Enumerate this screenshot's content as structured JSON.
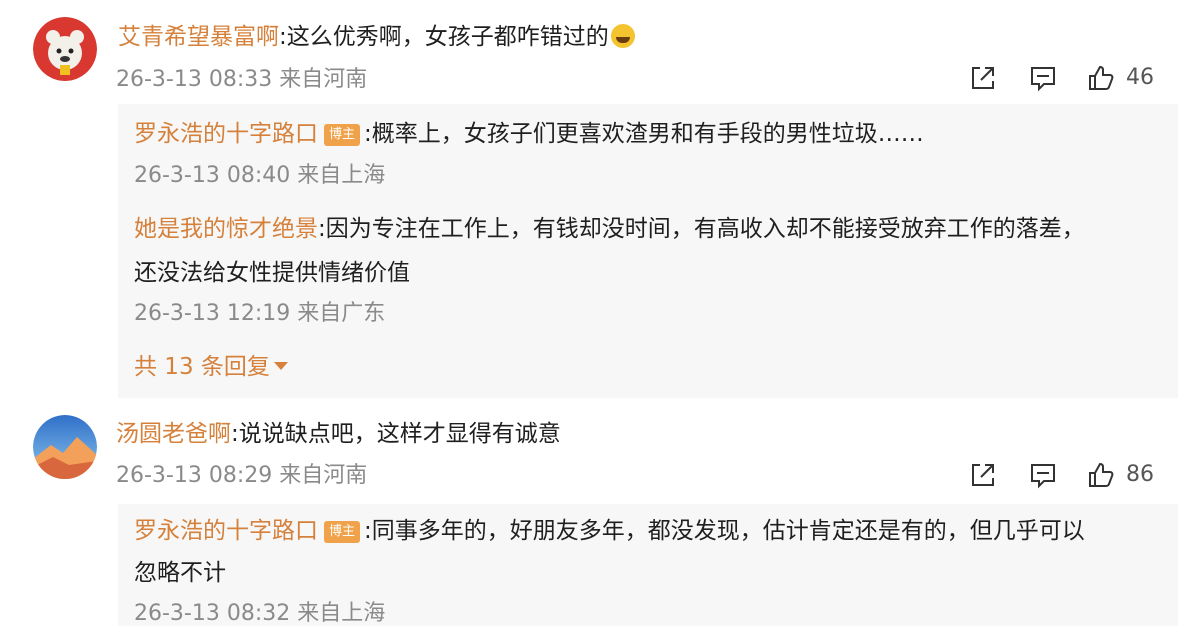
{
  "comments": [
    {
      "user": "艾青希望暴富啊",
      "text": "这么优秀啊，女孩子都咋错过的",
      "emoji": "laughing-emoji",
      "meta": "26-3-13 08:33 来自河南",
      "likes": "46",
      "replies": [
        {
          "user": "罗永浩的十字路口",
          "badge": "博主",
          "text": "概率上，女孩子们更喜欢渣男和有手段的男性垃圾……",
          "meta": "26-3-13 08:40 来自上海"
        },
        {
          "user": "她是我的惊才绝景",
          "text_line1": "因为专注在工作上，有钱却没时间，有高收入却不能接受放弃工作的落差，",
          "text_line2": "还没法给女性提供情绪价值",
          "meta": "26-3-13 12:19 来自广东"
        }
      ],
      "more_replies": "共 13 条回复"
    },
    {
      "user": "汤圆老爸啊",
      "text": "说说缺点吧，这样才显得有诚意",
      "meta": "26-3-13 08:29 来自河南",
      "likes": "86",
      "replies": [
        {
          "user": "罗永浩的十字路口",
          "badge": "博主",
          "text_line1": "同事多年的，好朋友多年，都没发现，估计肯定还是有的，但几乎可以",
          "text_line2": "忽略不计",
          "meta": "26-3-13 08:32 来自上海"
        }
      ]
    }
  ],
  "icons": {
    "share": "share-icon",
    "comment": "comment-icon",
    "like": "thumbs-up-icon"
  },
  "colors": {
    "username": "#d5813b",
    "meta": "#8a8a8a",
    "reply_bg": "#f7f7f7",
    "badge": "#f0a24a"
  }
}
